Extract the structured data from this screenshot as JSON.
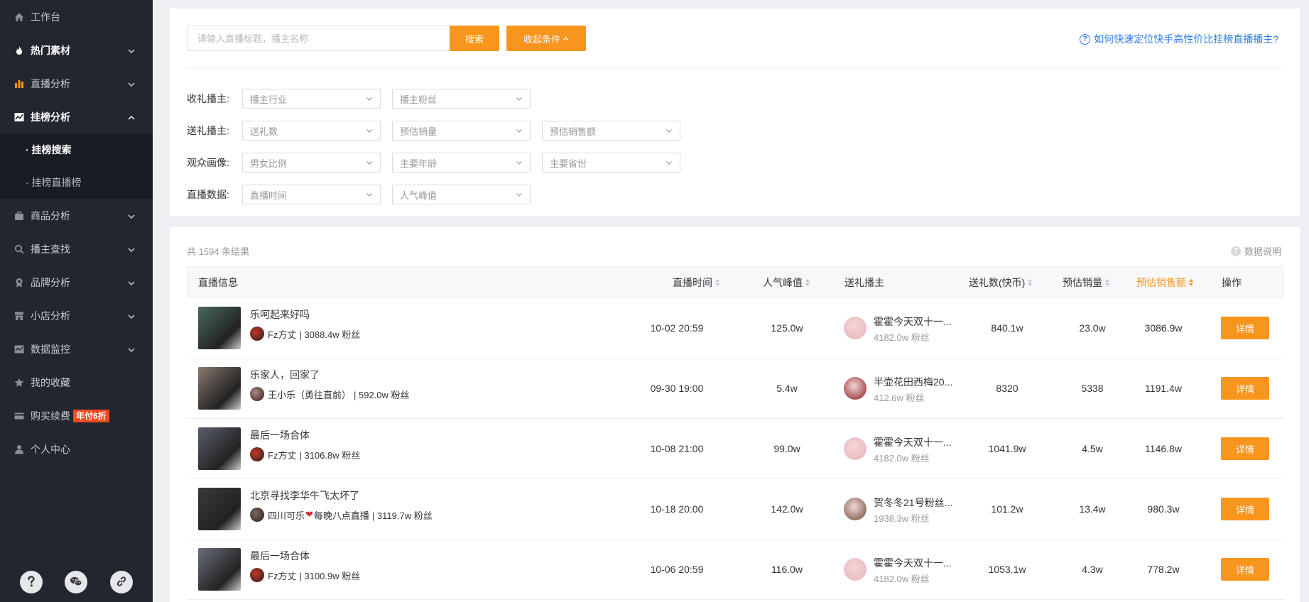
{
  "sidebar": {
    "items": [
      {
        "label": "工作台",
        "icon": "home-icon"
      },
      {
        "label": "热门素材",
        "icon": "flame-icon"
      },
      {
        "label": "直播分析",
        "icon": "bar-chart-icon"
      },
      {
        "label": "挂榜分析",
        "icon": "trend-chart-icon"
      },
      {
        "label": "商品分析",
        "icon": "bag-icon"
      },
      {
        "label": "播主查找",
        "icon": "search-icon"
      },
      {
        "label": "品牌分析",
        "icon": "award-icon"
      },
      {
        "label": "小店分析",
        "icon": "store-icon"
      },
      {
        "label": "数据监控",
        "icon": "monitor-icon"
      },
      {
        "label": "我的收藏",
        "icon": "star-icon"
      },
      {
        "label": "购买续费",
        "icon": "card-icon",
        "badge": "年付6折"
      },
      {
        "label": "个人中心",
        "icon": "user-icon"
      }
    ],
    "sub_items": [
      "· 挂榜搜索",
      "· 挂榜直播榜"
    ]
  },
  "search": {
    "placeholder": "请输入直播标题，播主名称",
    "search_label": "搜索",
    "collapse_label": "收起条件",
    "help_text": "如何快速定位快手高性价比挂榜直播播主?"
  },
  "filters": [
    {
      "label": "收礼播主:",
      "selects": [
        "播主行业",
        "播主粉丝"
      ]
    },
    {
      "label": "送礼播主:",
      "selects": [
        "送礼数",
        "预估销量",
        "预估销售额"
      ]
    },
    {
      "label": "观众画像:",
      "selects": [
        "男女比例",
        "主要年龄",
        "主要省份"
      ]
    },
    {
      "label": "直播数据:",
      "selects": [
        "直播时间",
        "人气峰值"
      ]
    }
  ],
  "results": {
    "total_text": "共 1594 条结果",
    "data_note": "数据说明",
    "columns": [
      "直播信息",
      "直播时间",
      "人气峰值",
      "送礼播主",
      "送礼数(快币)",
      "预估销量",
      "预估销售额",
      "操作"
    ],
    "rows": [
      {
        "title": "乐呵起来好吗",
        "anchor": "Fz方丈",
        "anchor_fans": "| 3088.4w 粉丝",
        "time": "10-02 20:59",
        "peak": "125.0w",
        "gift_name": "霍霍今天双十一...",
        "gift_fans": "4182.0w 粉丝",
        "gifts": "840.1w",
        "sales": "23.0w",
        "revenue": "3086.9w",
        "action": "详情",
        "thumb_color": "#4a6a5a",
        "av_color": "#c0392b",
        "gift_av_color": "#e8b4b8"
      },
      {
        "title": "乐家人，回家了",
        "anchor": "王小乐（勇往直前）",
        "anchor_fans": "| 592.0w 粉丝",
        "time": "09-30 19:00",
        "peak": "5.4w",
        "gift_name": "半壶花田西梅20...",
        "gift_fans": "412.6w 粉丝",
        "gifts": "8320",
        "sales": "5338",
        "revenue": "1191.4w",
        "action": "详情",
        "thumb_color": "#8a7a70",
        "av_color": "#b08a80",
        "gift_av_color": "#8a1a1a"
      },
      {
        "title": "最后一场合体",
        "anchor": "Fz方丈",
        "anchor_fans": "| 3106.8w 粉丝",
        "time": "10-08 21:00",
        "peak": "99.0w",
        "gift_name": "霍霍今天双十一...",
        "gift_fans": "4182.0w 粉丝",
        "gifts": "1041.9w",
        "sales": "4.5w",
        "revenue": "1146.8w",
        "action": "详情",
        "thumb_color": "#5a5f6a",
        "av_color": "#c0392b",
        "gift_av_color": "#e8b4b8"
      },
      {
        "title": "北京寻找李华牛飞太坏了",
        "anchor": "四川可乐",
        "anchor_suffix": "每晚八点直播",
        "anchor_fans": "| 3119.7w 粉丝",
        "time": "10-18 20:00",
        "peak": "142.0w",
        "gift_name": "贺冬冬21号粉丝...",
        "gift_fans": "1938.3w 粉丝",
        "gifts": "101.2w",
        "sales": "13.4w",
        "revenue": "980.3w",
        "action": "详情",
        "thumb_color": "#3a3a3a",
        "av_color": "#7a6a60",
        "gift_av_color": "#6a4a30"
      },
      {
        "title": "最后一场合体",
        "anchor": "Fz方丈",
        "anchor_fans": "| 3100.9w 粉丝",
        "time": "10-06 20:59",
        "peak": "116.0w",
        "gift_name": "霍霍今天双十一...",
        "gift_fans": "4182.0w 粉丝",
        "gifts": "1053.1w",
        "sales": "4.3w",
        "revenue": "778.2w",
        "action": "详情",
        "thumb_color": "#6a6f7a",
        "av_color": "#c0392b",
        "gift_av_color": "#e8b4b8"
      }
    ]
  },
  "bottom_icons": [
    "help-icon",
    "wechat-icon",
    "link-icon"
  ],
  "colors": {
    "accent": "#f8951d",
    "sidebar_bg": "#22262e",
    "link": "#2d7be5",
    "badge": "#f04b1f"
  }
}
